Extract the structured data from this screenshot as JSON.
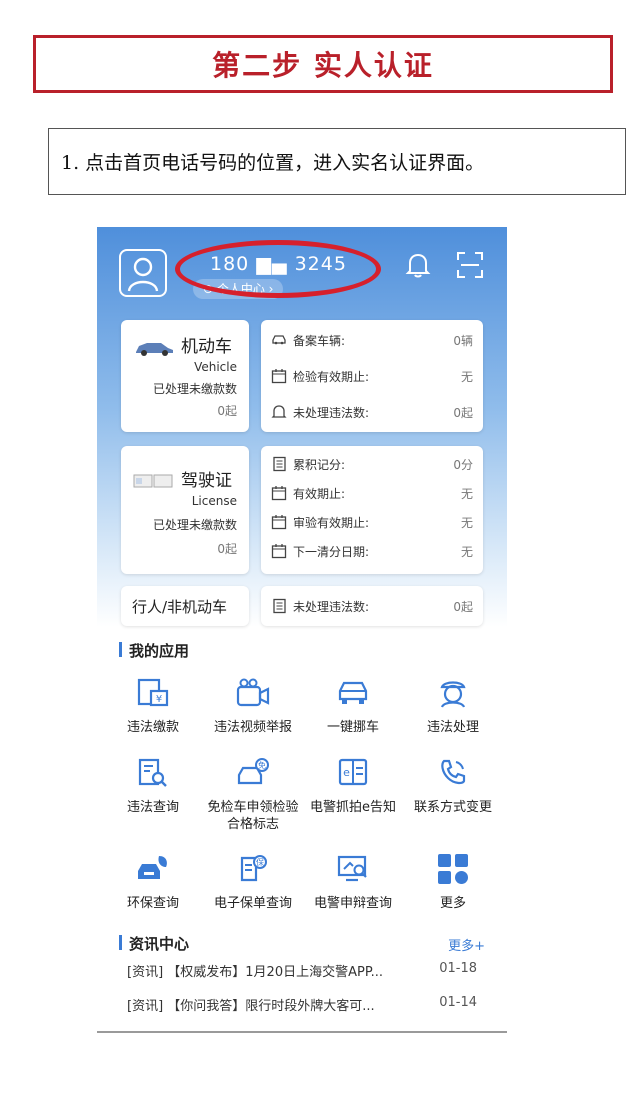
{
  "step_title": "第二步 实人认证",
  "instruction": "1. 点击首页电话号码的位置，进入实名认证界面。",
  "header": {
    "phone": "180  ▆▄ 3245",
    "personal_center": "⊙ 个人中心 ›",
    "icons": [
      "avatar-icon",
      "bell-icon",
      "scan-icon"
    ]
  },
  "vehicle_card": {
    "title": "机动车",
    "subtitle": "Vehicle",
    "label": "已处理未缴款数",
    "value": "0起"
  },
  "vehicle_info": [
    {
      "label": "备案车辆:",
      "value": "0辆"
    },
    {
      "label": "检验有效期止:",
      "value": "无"
    },
    {
      "label": "未处理违法数:",
      "value": "0起"
    }
  ],
  "license_card": {
    "title": "驾驶证",
    "subtitle": "License",
    "label": "已处理未缴款数",
    "value": "0起"
  },
  "license_info": [
    {
      "label": "累积记分:",
      "value": "0分"
    },
    {
      "label": "有效期止:",
      "value": "无"
    },
    {
      "label": "审验有效期止:",
      "value": "无"
    },
    {
      "label": "下一清分日期:",
      "value": "无"
    }
  ],
  "pedestrian_card": {
    "title": "行人/非机动车"
  },
  "pedestrian_info": {
    "label": "未处理违法数:",
    "value": "0起"
  },
  "my_apps": {
    "title": "我的应用",
    "items": [
      {
        "label": "违法缴款",
        "icon": "payment-icon"
      },
      {
        "label": "违法视频举报",
        "icon": "video-report-icon"
      },
      {
        "label": "一键挪车",
        "icon": "move-car-icon"
      },
      {
        "label": "违法处理",
        "icon": "police-icon"
      },
      {
        "label": "违法查询",
        "icon": "query-icon"
      },
      {
        "label": "免检车申领检验合格标志",
        "icon": "exempt-car-icon"
      },
      {
        "label": "电警抓拍e告知",
        "icon": "e-notice-icon"
      },
      {
        "label": "联系方式变更",
        "icon": "phone-change-icon"
      },
      {
        "label": "环保查询",
        "icon": "eco-car-icon"
      },
      {
        "label": "电子保单查询",
        "icon": "insurance-icon"
      },
      {
        "label": "电警申辩查询",
        "icon": "appeal-query-icon"
      },
      {
        "label": "更多",
        "icon": "more-grid-icon"
      }
    ]
  },
  "news": {
    "title": "资讯中心",
    "more": "更多+",
    "items": [
      {
        "text": "[资讯] 【权威发布】1月20日上海交警APP...",
        "date": "01-18"
      },
      {
        "text": "[资讯] 【你问我答】限行时段外牌大客可...",
        "date": "01-14"
      }
    ]
  },
  "colors": {
    "accent_red": "#b9202a",
    "header_blue": "#4f8fdb",
    "icon_blue": "#3a7bd5"
  }
}
